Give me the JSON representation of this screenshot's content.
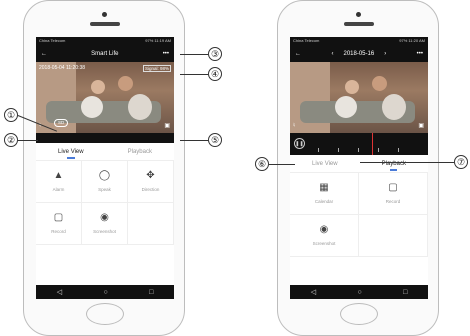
{
  "left_phone": {
    "status_left": "China Telecom",
    "status_right": "97% 11:19 AM",
    "title": "Smart Life",
    "back_icon": "arrow-left-icon",
    "more_label": "•••",
    "timestamp": "2018-05-04  11:20:38",
    "signal": "Signal: 98%",
    "sd_label": "SD",
    "tabs": [
      "Live View",
      "Playback"
    ],
    "controls": [
      {
        "icon": "alarm-icon",
        "label": "Alarm"
      },
      {
        "icon": "microphone-icon",
        "label": "Speak"
      },
      {
        "icon": "move-arrows-icon",
        "label": "Direction"
      },
      {
        "icon": "video-camera-icon",
        "label": "Record"
      },
      {
        "icon": "camera-icon",
        "label": "Screenshot"
      }
    ]
  },
  "right_phone": {
    "status_left": "China Telecom",
    "status_right": "97% 11:20 AM",
    "date": "2018-05-16",
    "more_label": "•••",
    "tabs": [
      "Live View",
      "Playback"
    ],
    "controls": [
      {
        "icon": "calendar-icon",
        "label": "Calendar"
      },
      {
        "icon": "video-camera-icon",
        "label": "Record"
      },
      {
        "icon": "camera-icon",
        "label": "Screenshot"
      }
    ]
  },
  "callouts": [
    "①",
    "②",
    "③",
    "④",
    "⑤",
    "⑥",
    "⑦"
  ]
}
